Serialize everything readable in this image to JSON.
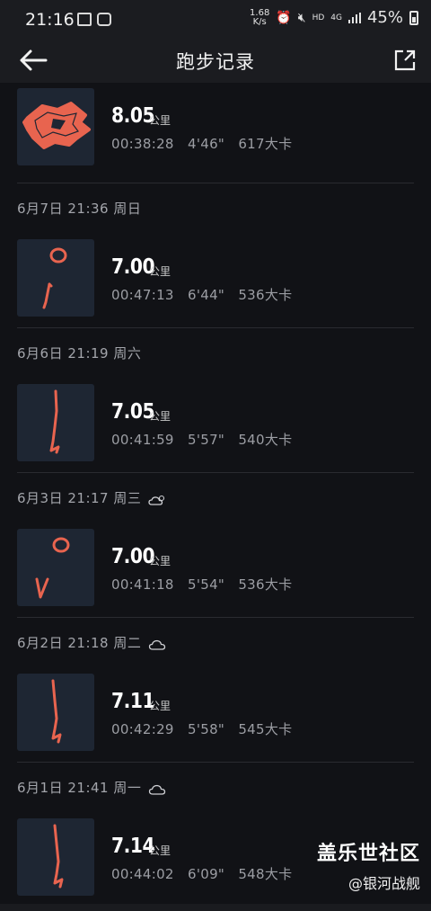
{
  "status_bar": {
    "time": "21:16",
    "net_speed_value": "1.68",
    "net_speed_unit": "K/s",
    "network": "HD",
    "signal": "4G",
    "battery": "45%"
  },
  "header": {
    "title": "跑步记录"
  },
  "runs": [
    {
      "date_label": "",
      "distance": "8.05",
      "unit": "公里",
      "stats": "00:38:28   4'46\"   617大卡",
      "weather": ""
    },
    {
      "date_label": "6月7日  21:36  周日",
      "distance": "7.00",
      "unit": "公里",
      "stats": "00:47:13   6'44\"   536大卡",
      "weather": ""
    },
    {
      "date_label": "6月6日  21:19  周六",
      "distance": "7.05",
      "unit": "公里",
      "stats": "00:41:59   5'57\"   540大卡",
      "weather": ""
    },
    {
      "date_label": "6月3日  21:17  周三",
      "distance": "7.00",
      "unit": "公里",
      "stats": "00:41:18   5'54\"   536大卡",
      "weather": "partly-cloudy-icon"
    },
    {
      "date_label": "6月2日  21:18  周二",
      "distance": "7.11",
      "unit": "公里",
      "stats": "00:42:29   5'58\"   545大卡",
      "weather": "cloud-icon"
    },
    {
      "date_label": "6月1日  21:41  周一",
      "distance": "7.14",
      "unit": "公里",
      "stats": "00:44:02   6'09\"   548大卡",
      "weather": "cloud-icon"
    }
  ],
  "watermark": {
    "title": "盖乐世社区",
    "subtitle": "@银河战舰"
  },
  "colors": {
    "background": "#111216",
    "route": "#e8644f",
    "thumb_bg": "#1e2633"
  }
}
